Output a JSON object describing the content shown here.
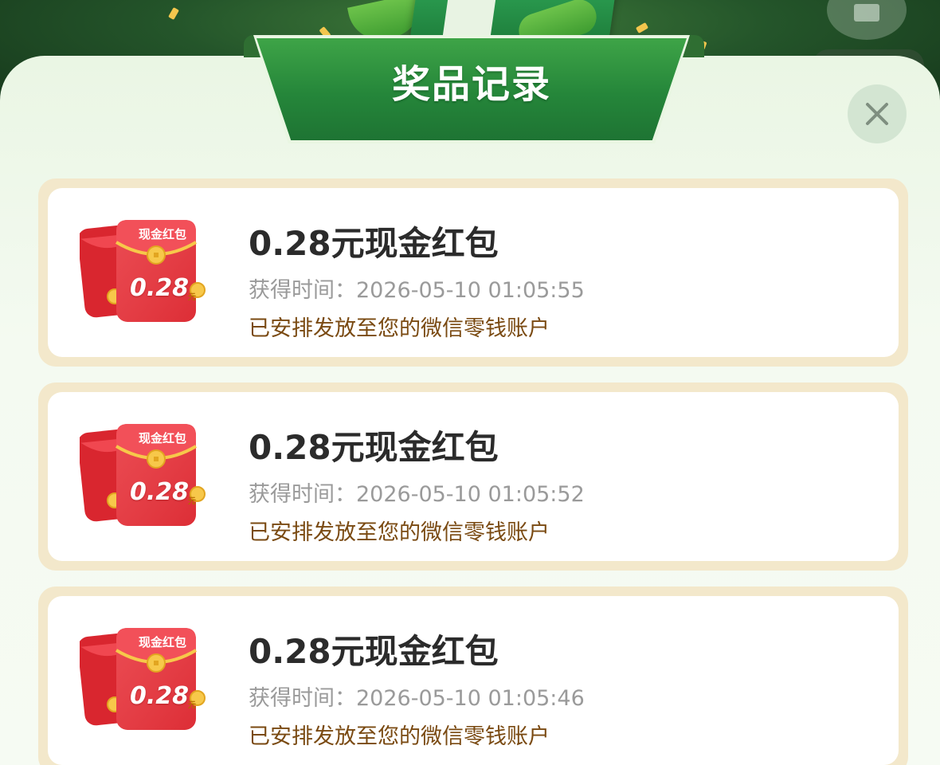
{
  "modal": {
    "title": "奖品记录",
    "close_icon": "close-icon"
  },
  "records": [
    {
      "title": "0.28元现金红包",
      "time_label": "获得时间：2026-05-10 01:05:55",
      "note": "已安排发放至您的微信零钱账户",
      "envelope_label": "现金红包",
      "envelope_amount": "0.28",
      "envelope_unit": "元"
    },
    {
      "title": "0.28元现金红包",
      "time_label": "获得时间：2026-05-10 01:05:52",
      "note": "已安排发放至您的微信零钱账户",
      "envelope_label": "现金红包",
      "envelope_amount": "0.28",
      "envelope_unit": "元"
    },
    {
      "title": "0.28元现金红包",
      "time_label": "获得时间：2026-05-10 01:05:46",
      "note": "已安排发放至您的微信零钱账户",
      "envelope_label": "现金红包",
      "envelope_amount": "0.28",
      "envelope_unit": "元"
    }
  ],
  "colors": {
    "ribbon_green": "#25863a",
    "card_border": "#f3e8cb",
    "note_brown": "#7a4a12",
    "time_gray": "#9a9a9a",
    "title_dark": "#2b2b2b",
    "envelope_red": "#e8333b"
  }
}
